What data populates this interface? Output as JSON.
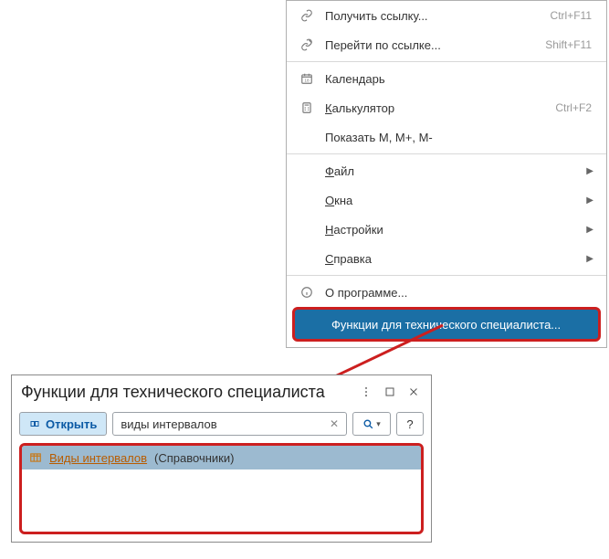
{
  "menu": {
    "get_link": "Получить ссылку...",
    "get_link_sc": "Ctrl+F11",
    "go_link": "Перейти по ссылке...",
    "go_link_sc": "Shift+F11",
    "calendar": "Календарь",
    "calculator_pre": "К",
    "calculator_rest": "алькулятор",
    "calculator_sc": "Ctrl+F2",
    "show_m": "Показать М, М+, М-",
    "file_pre": "Ф",
    "file_rest": "айл",
    "windows_pre": "О",
    "windows_rest": "кна",
    "settings_pre": "Н",
    "settings_rest": "астройки",
    "help_pre": "С",
    "help_rest": "правка",
    "about": "О программе...",
    "tech": "Функции для технического специалиста..."
  },
  "dialog": {
    "title": "Функции для технического специалиста",
    "open": "Открыть",
    "search_value": "виды интервалов",
    "help": "?",
    "result_name": "Виды интервалов",
    "result_cat": "(Справочники)"
  }
}
